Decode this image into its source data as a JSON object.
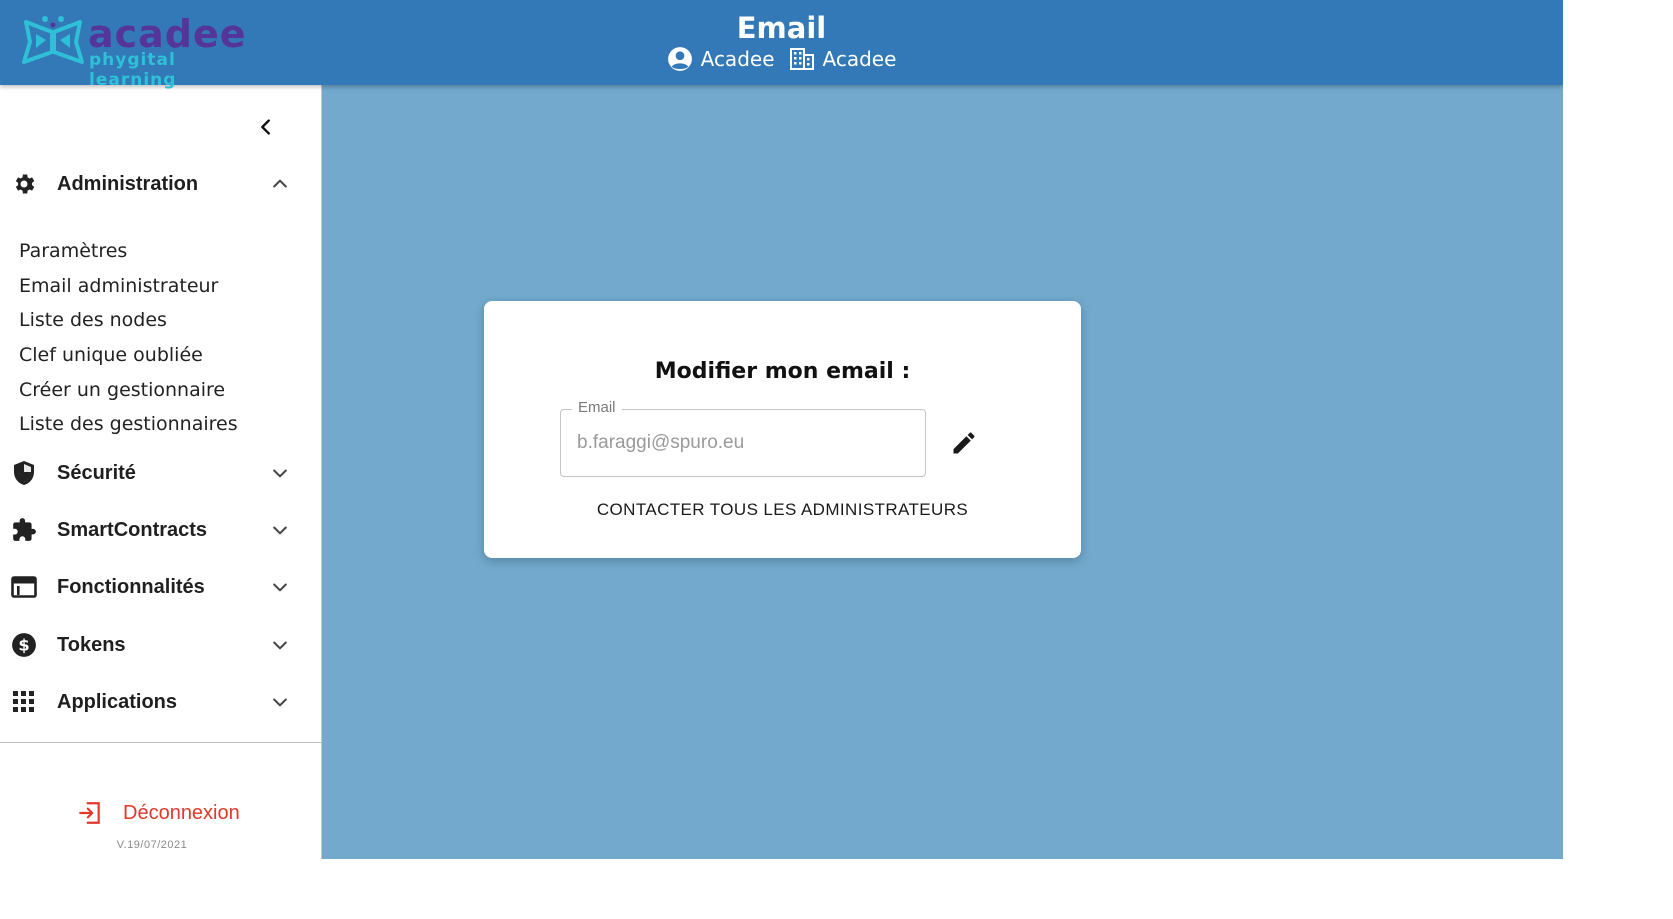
{
  "header": {
    "logo_name": "acadee",
    "logo_tagline": "phygital learning",
    "title": "Email",
    "user_name": "Acadee",
    "organization_name": "Acadee"
  },
  "sidebar": {
    "sections": [
      {
        "label": "Administration",
        "icon": "gear-icon",
        "expanded": true,
        "items": [
          "Paramètres",
          "Email administrateur",
          "Liste des nodes",
          "Clef unique oubliée",
          "Créer un gestionnaire",
          "Liste des gestionnaires"
        ]
      },
      {
        "label": "Sécurité",
        "icon": "shield-icon",
        "expanded": false
      },
      {
        "label": "SmartContracts",
        "icon": "puzzle-icon",
        "expanded": false
      },
      {
        "label": "Fonctionnalités",
        "icon": "web-window-icon",
        "expanded": false
      },
      {
        "label": "Tokens",
        "icon": "dollar-coin-icon",
        "expanded": false
      },
      {
        "label": "Applications",
        "icon": "apps-grid-icon",
        "expanded": false
      }
    ],
    "logout_label": "Déconnexion",
    "version": "V.19/07/2021"
  },
  "card": {
    "title": "Modifier mon email :",
    "email_label": "Email",
    "email_value": "b.faraggi@spuro.eu",
    "contact_button": "CONTACTER TOUS LES ADMINISTRATEURS"
  },
  "colors": {
    "header_bg": "#3379b7",
    "page_bg": "#72a9cd",
    "logout": "#e0392b",
    "logo_primary": "#55359a",
    "logo_accent": "#2ec0d6"
  }
}
